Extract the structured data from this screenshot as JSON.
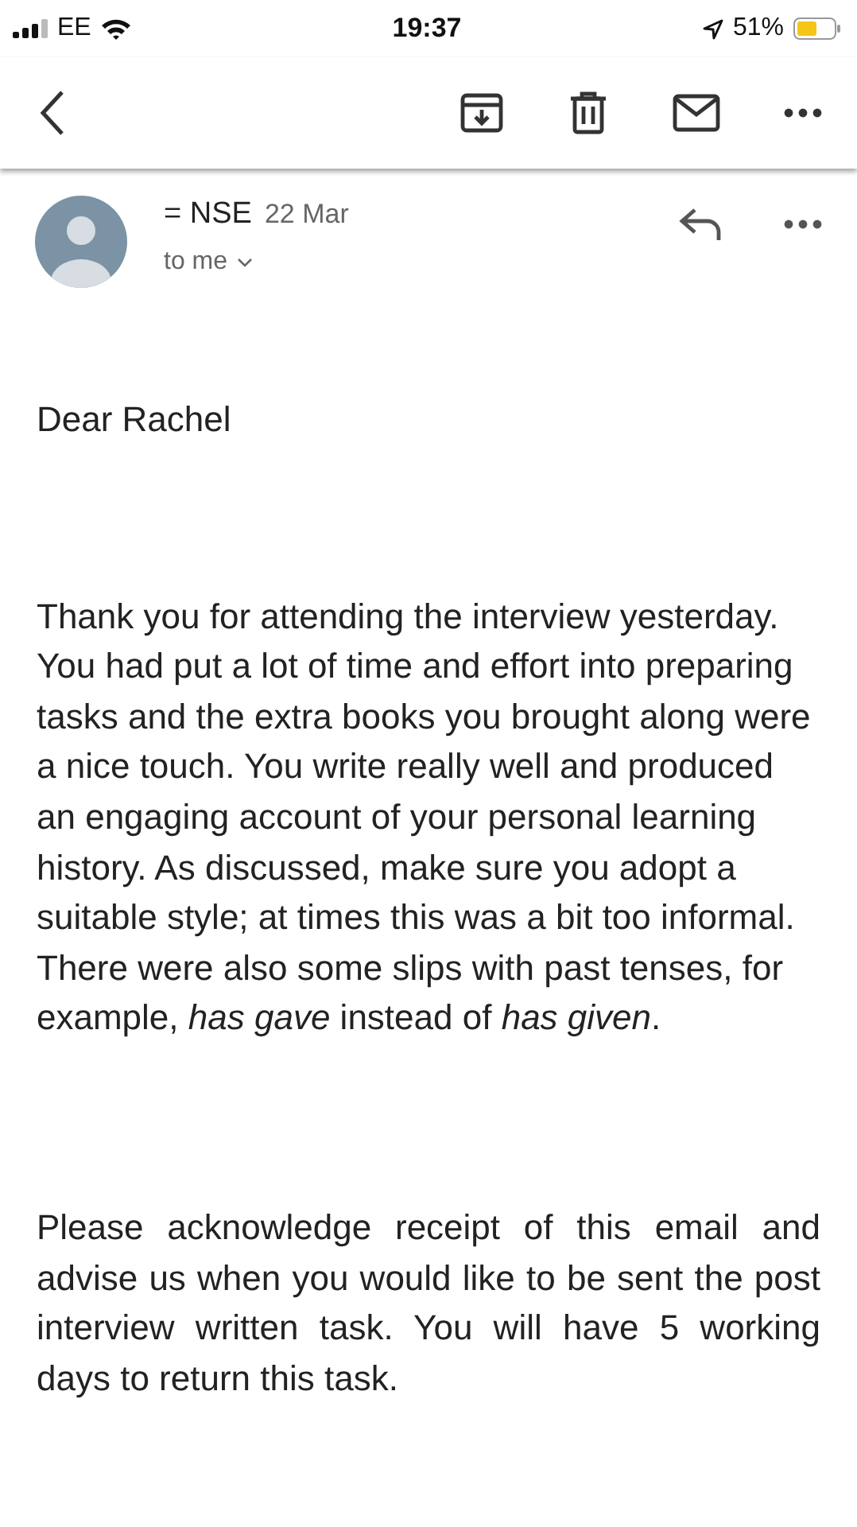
{
  "status_bar": {
    "carrier": "EE",
    "time": "19:37",
    "battery": "51%"
  },
  "message": {
    "sender": "= NSE",
    "date": "22 Mar",
    "recipient": "to me"
  },
  "body": [
    {
      "kind": "plain",
      "text": "Dear Rachel"
    },
    {
      "kind": "plain",
      "text": "Thank you for attending the interview yesterday. You had put a lot of time and effort into preparing tasks and the extra books you brought along were a nice touch. You write really well and produced an engaging account of your personal learning history. As discussed, make sure you adopt a suitable style; at times this was a bit too informal. There were also some slips with past tenses, for example, *has gave* instead of *has given*."
    },
    {
      "kind": "justified",
      "text": "Please acknowledge receipt of this email and advise us when you would like to be sent the post interview written task. You will have 5 working days to return this task."
    }
  ]
}
